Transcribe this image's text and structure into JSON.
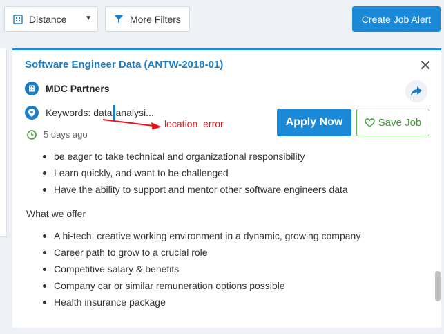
{
  "toolbar": {
    "distance_label": "Distance",
    "distance_icon": "building-icon",
    "more_filters_label": "More Filters",
    "more_filters_icon": "funnel-icon",
    "create_alert_label": "Create Job Alert"
  },
  "job": {
    "title": "Software Engineer Data (ANTW-2018-01)",
    "company": "MDC Partners",
    "keywords_prefix": "Keywords: data",
    "keywords_suffix": "analysi...",
    "posted": "5 days ago",
    "apply_label": "Apply Now",
    "save_label": "Save Job"
  },
  "description": {
    "requirements": [
      "be eager to take technical and organizational responsibility",
      "Learn quickly, and want to be challenged",
      "Have the ability to support and mentor other software engineers data"
    ],
    "offer_heading": "What we offer",
    "offers": [
      "A hi-tech, creative working environment in a dynamic, growing company",
      "Career path to grow to a crucial role",
      "Competitive salary & benefits",
      "Company car or similar remuneration options possible",
      "Health insurance package"
    ]
  },
  "annotation": {
    "text": "location  error"
  },
  "colors": {
    "primary": "#1a8ad8",
    "link": "#1a7dc8",
    "save_green": "#3e9b34",
    "annotation_red": "#e8141b"
  }
}
